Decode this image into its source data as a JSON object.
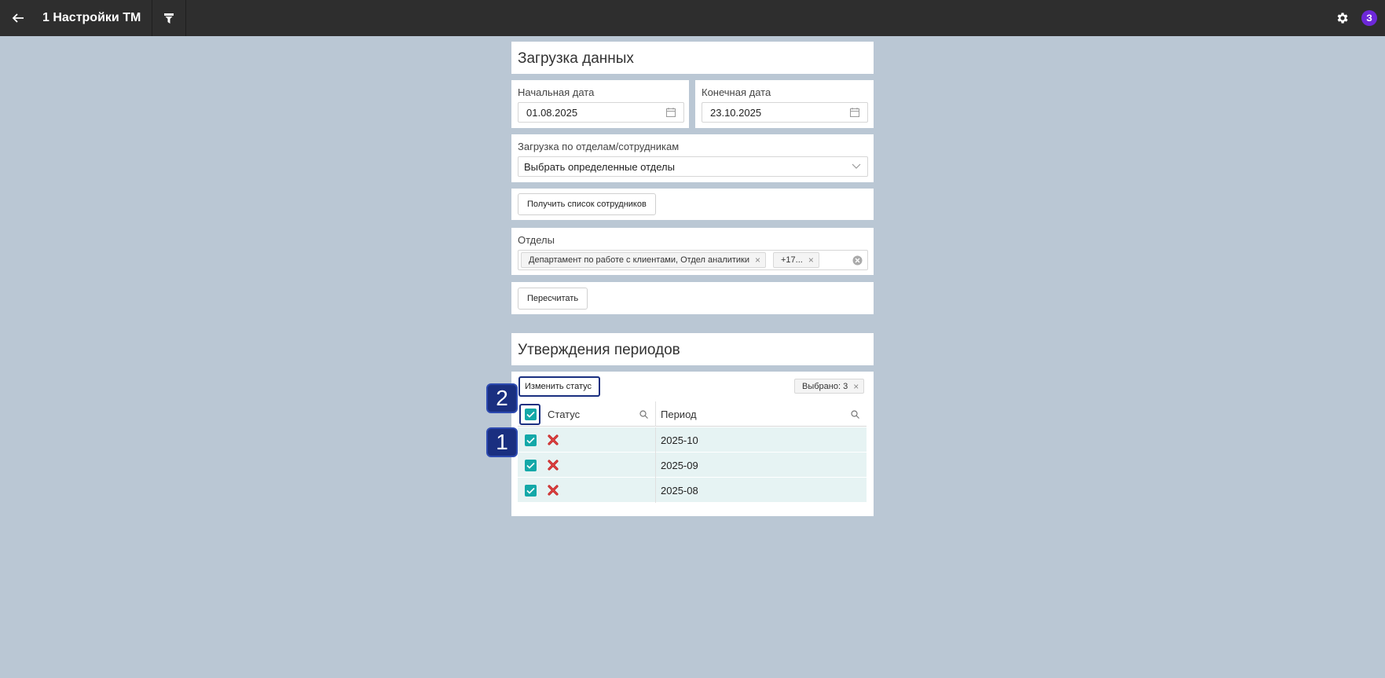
{
  "topbar": {
    "title": "1 Настройки ТМ",
    "avatar_letter": "З"
  },
  "load_section": {
    "heading": "Загрузка данных",
    "start_date_label": "Начальная дата",
    "start_date_value": "01.08.2025",
    "end_date_label": "Конечная дата",
    "end_date_value": "23.10.2025",
    "mode_label": "Загрузка по отделам/сотрудникам",
    "mode_value": "Выбрать определенные отделы",
    "get_employees_button": "Получить список сотрудников",
    "departments_label": "Отделы",
    "departments_tags": [
      "Департамент по работе с клиентами, Отдел аналитики",
      "+17..."
    ],
    "recalc_button": "Пересчитать"
  },
  "approval_section": {
    "heading": "Утверждения периодов",
    "change_status_button": "Изменить статус",
    "selected_badge": "Выбрано: 3",
    "columns": [
      "Статус",
      "Период"
    ],
    "rows": [
      {
        "status": "rejected",
        "period": "2025-10"
      },
      {
        "status": "rejected",
        "period": "2025-09"
      },
      {
        "status": "rejected",
        "period": "2025-08"
      }
    ]
  },
  "markers": [
    "1",
    "2"
  ],
  "colors": {
    "topbar": "#2e2e2e",
    "background": "#bac7d4",
    "checkbox": "#14a8a8",
    "row_selected": "#e6f3f3",
    "marker": "#1a2f80",
    "avatar": "#6d28d9",
    "status_rejected": "#c62828"
  }
}
